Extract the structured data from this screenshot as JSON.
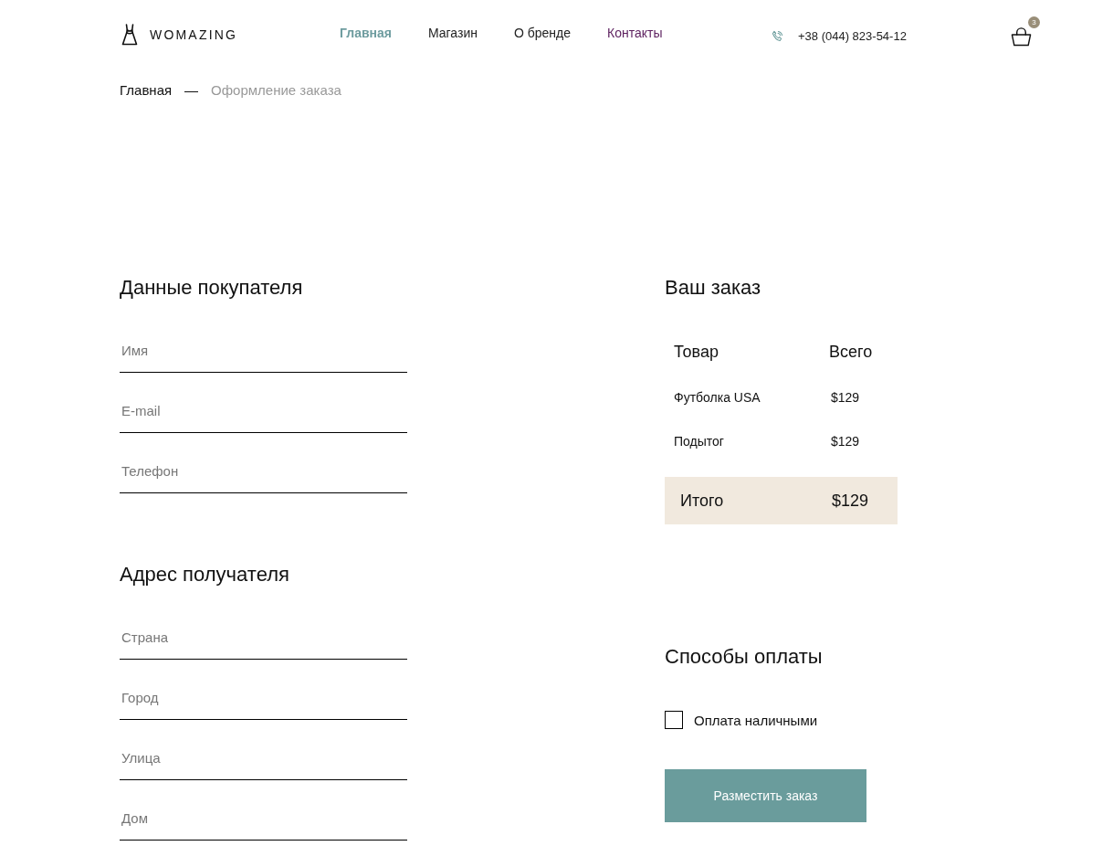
{
  "header": {
    "logo": {
      "text": "WOMAZING"
    },
    "nav": [
      {
        "label": "Главная",
        "selected": true,
        "visited": false
      },
      {
        "label": "Магазин",
        "selected": false,
        "visited": false
      },
      {
        "label": "О бренде",
        "selected": false,
        "visited": false
      },
      {
        "label": "Контакты",
        "selected": false,
        "visited": true
      }
    ],
    "phone": "+38 (044) 823-54-12",
    "cart": {
      "count": "3"
    }
  },
  "breadcrumb": {
    "separator": "—",
    "items": [
      {
        "label": "Главная",
        "current": false
      },
      {
        "label": "Оформление заказа",
        "current": true
      }
    ]
  },
  "buyer": {
    "title": "Данные покупателя",
    "fields": [
      {
        "placeholder": "Имя"
      },
      {
        "placeholder": "E-mail"
      },
      {
        "placeholder": "Телефон"
      }
    ]
  },
  "address": {
    "title": "Адрес получателя",
    "fields": [
      {
        "placeholder": "Страна"
      },
      {
        "placeholder": "Город"
      },
      {
        "placeholder": "Улица"
      },
      {
        "placeholder": "Дом"
      }
    ]
  },
  "order": {
    "title": "Ваш заказ",
    "columns": [
      "Товар",
      "Всего"
    ],
    "rows": [
      [
        "Футболка USA",
        "$129"
      ],
      [
        "Подытог",
        "$129"
      ]
    ],
    "total": {
      "label": "Итого",
      "value": "$129"
    }
  },
  "payment": {
    "title": "Способы оплаты",
    "options": [
      {
        "label": "Оплата наличными",
        "checked": false
      }
    ]
  },
  "submit": {
    "label": "Разместить заказ"
  }
}
